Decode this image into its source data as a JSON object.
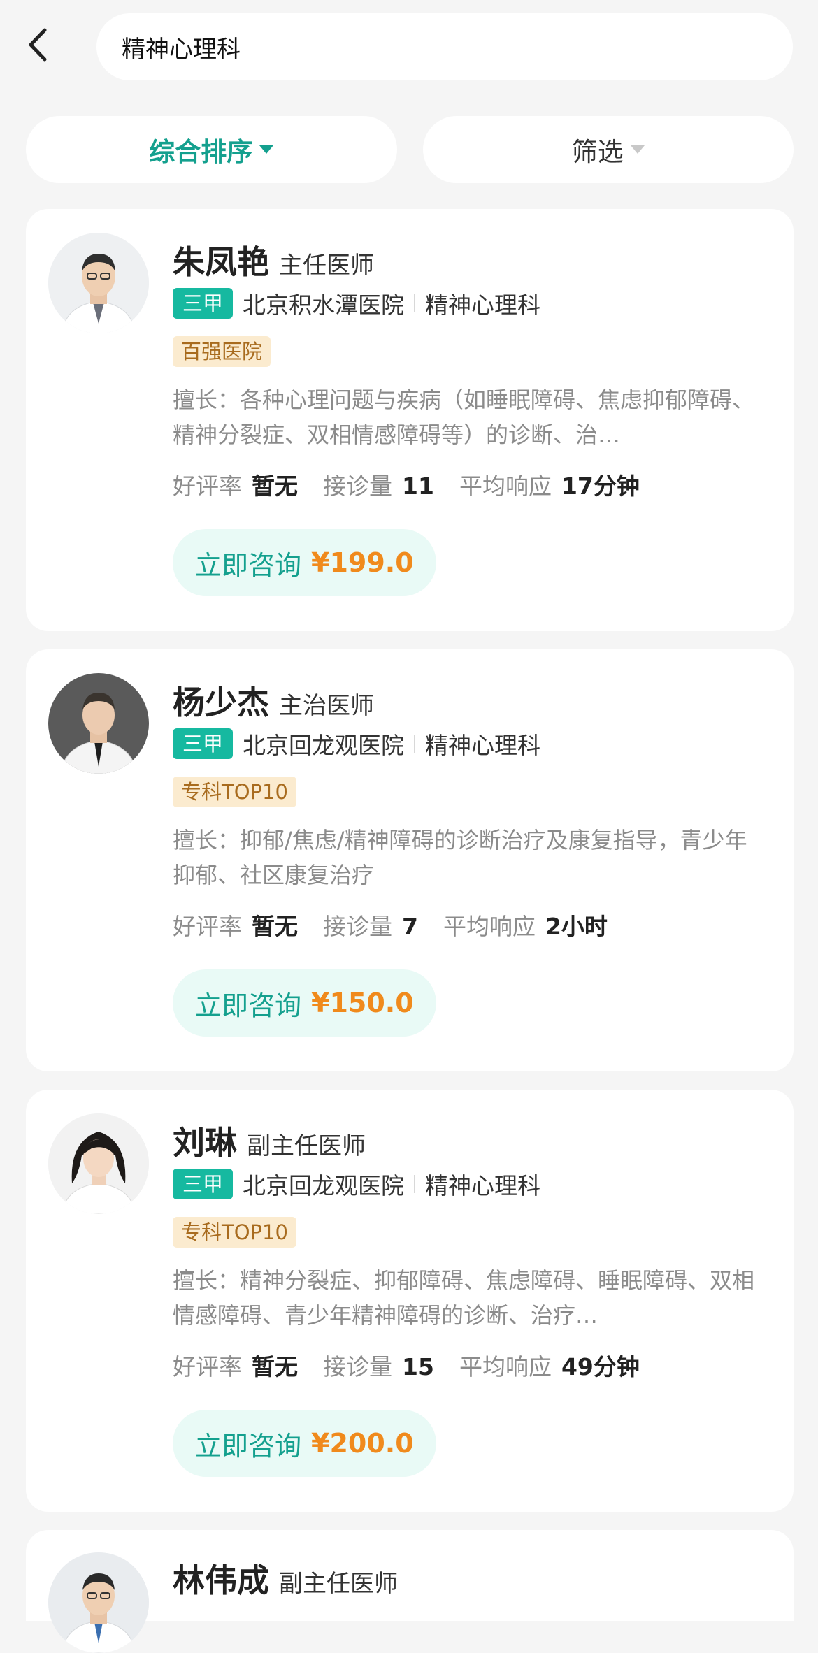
{
  "search": {
    "query": "精神心理科"
  },
  "filters": {
    "sort_label": "综合排序",
    "filter_label": "筛选"
  },
  "colors": {
    "accent": "#14a08e",
    "grade_badge": "#16b9a0",
    "price": "#f08a1c",
    "tag_bg": "#fbebcf",
    "tag_text": "#a86b1e"
  },
  "labels": {
    "rating": "好评率",
    "visits": "接诊量",
    "response": "平均响应",
    "consult": "立即咨询"
  },
  "doctors": [
    {
      "name": "朱凤艳",
      "title": "主任医师",
      "grade": "三甲",
      "hospital": "北京积水潭医院",
      "department": "精神心理科",
      "tag": "百强医院",
      "skill": "擅长：各种心理问题与疾病（如睡眠障碍、焦虑抑郁障碍、精神分裂症、双相情感障碍等）的诊断、治…",
      "rating": "暂无",
      "visits": "11",
      "response": "17分钟",
      "price": "¥199.0",
      "avatar_icon": "doctor-photo-male"
    },
    {
      "name": "杨少杰",
      "title": "主治医师",
      "grade": "三甲",
      "hospital": "北京回龙观医院",
      "department": "精神心理科",
      "tag": "专科TOP10",
      "skill": "擅长：抑郁/焦虑/精神障碍的诊断治疗及康复指导，青少年抑郁、社区康复治疗",
      "rating": "暂无",
      "visits": "7",
      "response": "2小时",
      "price": "¥150.0",
      "avatar_icon": "doctor-photo-male"
    },
    {
      "name": "刘琳",
      "title": "副主任医师",
      "grade": "三甲",
      "hospital": "北京回龙观医院",
      "department": "精神心理科",
      "tag": "专科TOP10",
      "skill": "擅长：精神分裂症、抑郁障碍、焦虑障碍、睡眠障碍、双相情感障碍、青少年精神障碍的诊断、治疗…",
      "rating": "暂无",
      "visits": "15",
      "response": "49分钟",
      "price": "¥200.0",
      "avatar_icon": "doctor-photo-female"
    },
    {
      "name": "林伟成",
      "title": "副主任医师",
      "avatar_icon": "doctor-photo-male"
    }
  ]
}
